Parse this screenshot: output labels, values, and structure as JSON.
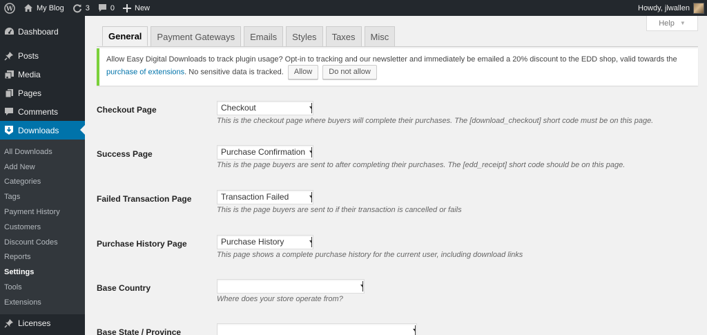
{
  "adminbar": {
    "site_name": "My Blog",
    "updates_count": "3",
    "comments_count": "0",
    "new_label": "New",
    "howdy": "Howdy, jlwallen"
  },
  "sidebar": {
    "items": [
      {
        "label": "Dashboard",
        "icon": "dashboard-icon"
      },
      {
        "label": "Posts",
        "icon": "pin-icon"
      },
      {
        "label": "Media",
        "icon": "media-icon"
      },
      {
        "label": "Pages",
        "icon": "pages-icon"
      },
      {
        "label": "Comments",
        "icon": "comments-icon"
      },
      {
        "label": "Downloads",
        "icon": "download-icon"
      }
    ],
    "submenu": [
      "All Downloads",
      "Add New",
      "Categories",
      "Tags",
      "Payment History",
      "Customers",
      "Discount Codes",
      "Reports",
      "Settings",
      "Tools",
      "Extensions"
    ],
    "current_submenu": "Settings",
    "licenses": {
      "label": "Licenses",
      "icon": "pin-icon"
    }
  },
  "help": {
    "label": "Help"
  },
  "tabs": [
    "General",
    "Payment Gateways",
    "Emails",
    "Styles",
    "Taxes",
    "Misc"
  ],
  "active_tab": "General",
  "notice": {
    "text": "Allow Easy Digital Downloads to track plugin usage? Opt-in to tracking and our newsletter and immediately be emailed a 20% discount to the EDD shop, valid towards the",
    "link": "purchase of extensions",
    "text_after": ". No sensitive data is tracked.",
    "allow_label": "Allow",
    "disallow_label": "Do not allow"
  },
  "settings": [
    {
      "label": "Checkout Page",
      "value": "Checkout",
      "desc": "This is the checkout page where buyers will complete their purchases. The [download_checkout] short code must be on this page."
    },
    {
      "label": "Success Page",
      "value": "Purchase Confirmation",
      "desc": "This is the page buyers are sent to after completing their purchases. The [edd_receipt] short code should be on this page."
    },
    {
      "label": "Failed Transaction Page",
      "value": "Transaction Failed",
      "desc": "This is the page buyers are sent to if their transaction is cancelled or fails"
    },
    {
      "label": "Purchase History Page",
      "value": "Purchase History",
      "desc": "This page shows a complete purchase history for the current user, including download links"
    },
    {
      "label": "Base Country",
      "value": "",
      "desc": "Where does your store operate from?"
    },
    {
      "label": "Base State / Province",
      "value": "",
      "desc": ""
    }
  ],
  "colors": {
    "accent": "#0073aa",
    "notice_border": "#7ad03a",
    "adminbar": "#23282d"
  }
}
